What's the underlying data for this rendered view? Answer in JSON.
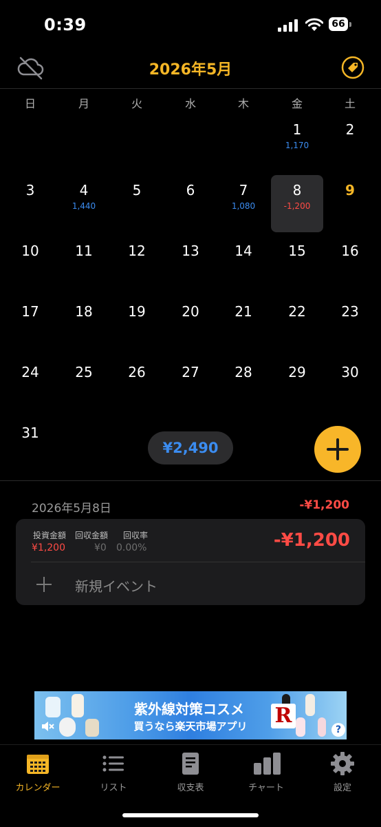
{
  "status_bar": {
    "time": "0:39",
    "battery": "66"
  },
  "header": {
    "title": "2026年5月"
  },
  "weekdays": [
    "日",
    "月",
    "火",
    "水",
    "木",
    "金",
    "土"
  ],
  "calendar": {
    "days": {
      "d1": {
        "num": "1",
        "amount": "1,170"
      },
      "d2": {
        "num": "2"
      },
      "d3": {
        "num": "3"
      },
      "d4": {
        "num": "4",
        "amount": "1,440"
      },
      "d5": {
        "num": "5"
      },
      "d6": {
        "num": "6"
      },
      "d7": {
        "num": "7",
        "amount": "1,080"
      },
      "d8": {
        "num": "8",
        "amount": "-1,200"
      },
      "d9": {
        "num": "9"
      },
      "d10": {
        "num": "10"
      },
      "d11": {
        "num": "11"
      },
      "d12": {
        "num": "12"
      },
      "d13": {
        "num": "13"
      },
      "d14": {
        "num": "14"
      },
      "d15": {
        "num": "15"
      },
      "d16": {
        "num": "16"
      },
      "d17": {
        "num": "17"
      },
      "d18": {
        "num": "18"
      },
      "d19": {
        "num": "19"
      },
      "d20": {
        "num": "20"
      },
      "d21": {
        "num": "21"
      },
      "d22": {
        "num": "22"
      },
      "d23": {
        "num": "23"
      },
      "d24": {
        "num": "24"
      },
      "d25": {
        "num": "25"
      },
      "d26": {
        "num": "26"
      },
      "d27": {
        "num": "27"
      },
      "d28": {
        "num": "28"
      },
      "d29": {
        "num": "29"
      },
      "d30": {
        "num": "30"
      },
      "d31": {
        "num": "31"
      }
    },
    "total": "¥2,490"
  },
  "detail": {
    "date": "2026年5月8日",
    "total": "-¥1,200",
    "card": {
      "invest_label": "投資金額",
      "invest_value": "¥1,200",
      "return_label": "回収金額",
      "return_value": "¥0",
      "rate_label": "回収率",
      "rate_value": "0.00%",
      "total": "-¥1,200",
      "new_event": "新規イベント"
    }
  },
  "ad": {
    "line1": "紫外線対策コスメ",
    "line2": "買うなら楽天市場アプリ",
    "logo": "R",
    "help": "?"
  },
  "tabs": [
    {
      "label": "カレンダー",
      "icon": "calendar-icon"
    },
    {
      "label": "リスト",
      "icon": "list-icon"
    },
    {
      "label": "収支表",
      "icon": "document-icon"
    },
    {
      "label": "チャート",
      "icon": "bar-chart-icon"
    },
    {
      "label": "設定",
      "icon": "gear-icon"
    }
  ],
  "colors": {
    "accent": "#f5b626",
    "positive": "#3b8cf0",
    "negative": "#ff4b45",
    "background": "#000000",
    "card": "#1c1c1e"
  }
}
